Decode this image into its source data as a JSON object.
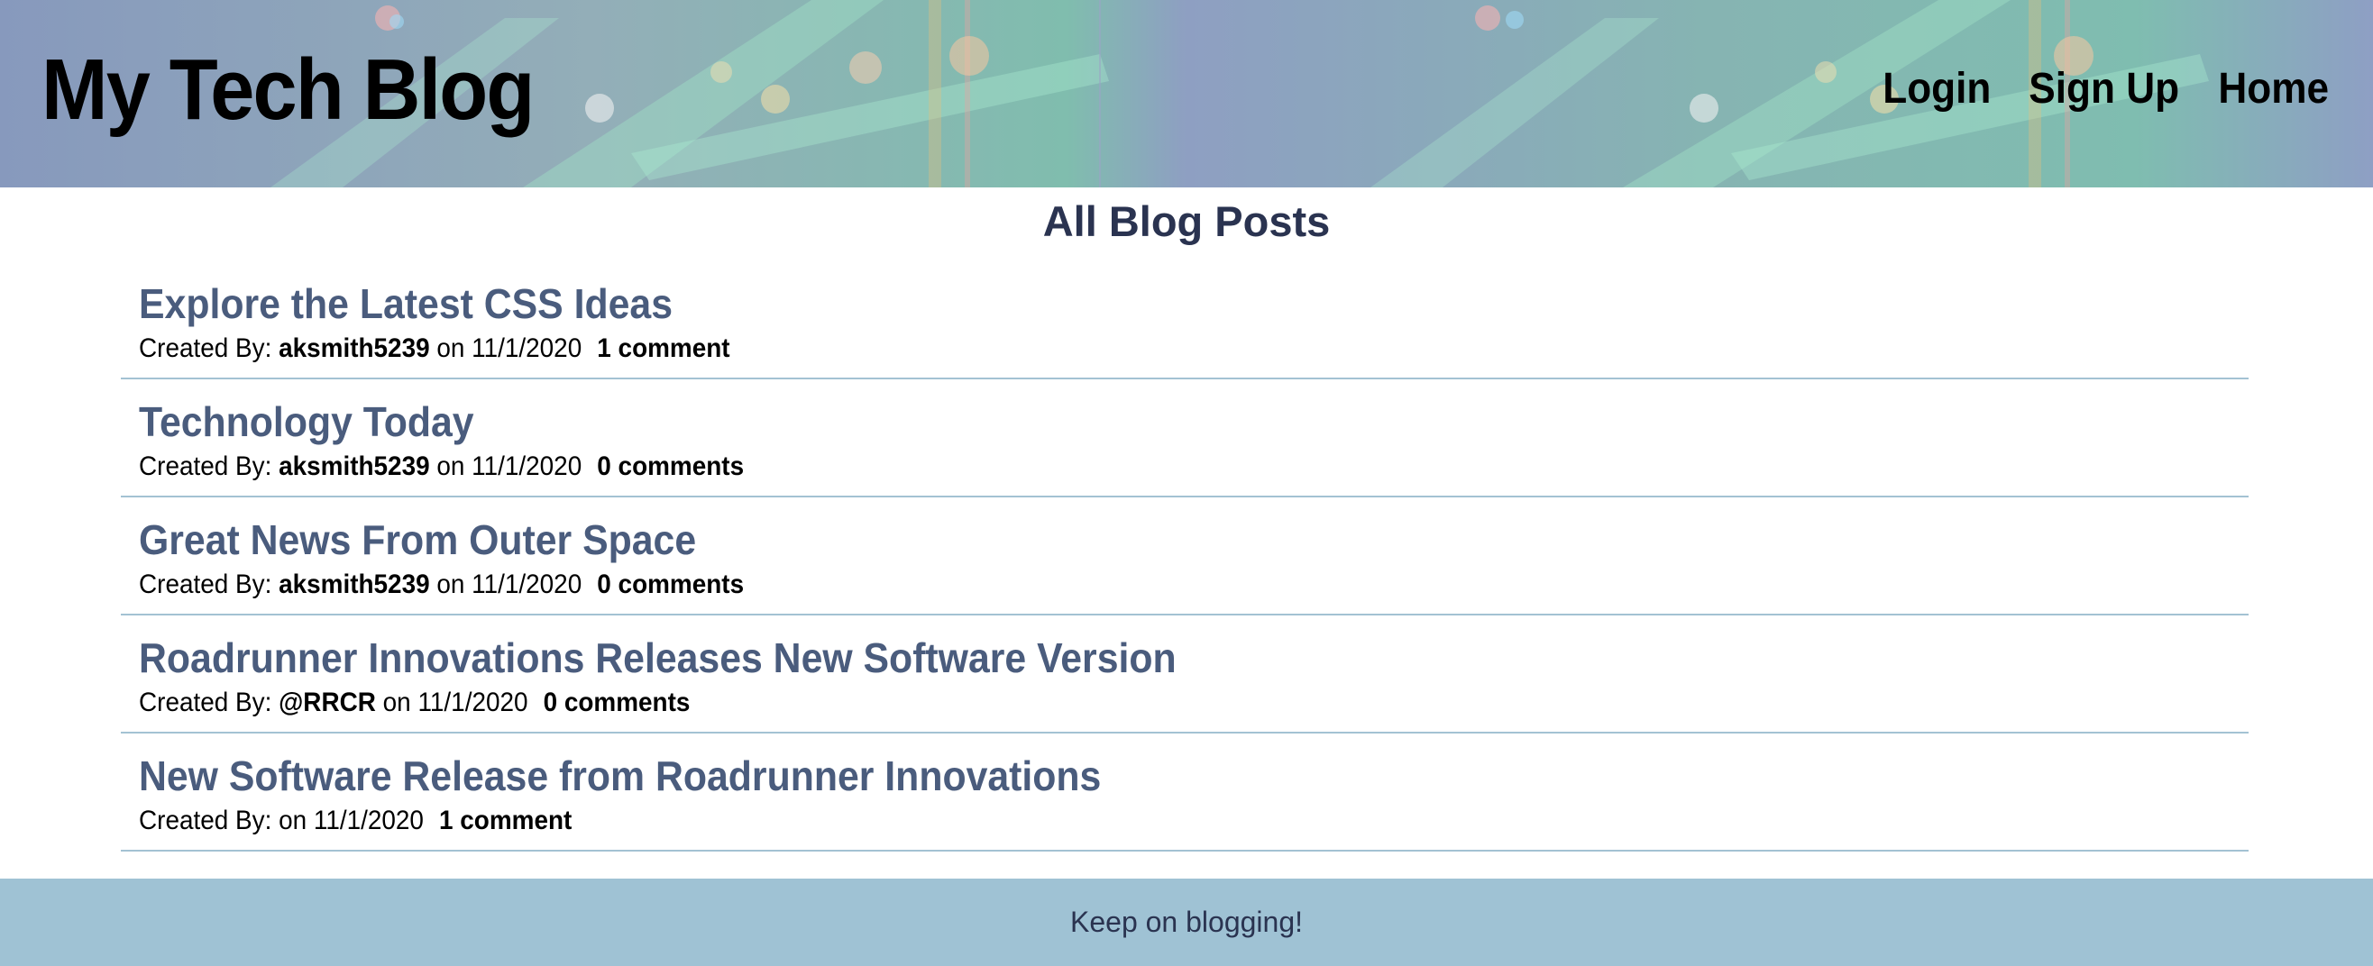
{
  "header": {
    "site_title": "My Tech Blog",
    "nav": [
      {
        "label": "Login"
      },
      {
        "label": "Sign Up"
      },
      {
        "label": "Home"
      }
    ]
  },
  "main": {
    "heading": "All Blog Posts",
    "posts": [
      {
        "title": "Explore the Latest CSS Ideas",
        "created_by_label": "Created By:",
        "author": "aksmith5239",
        "on_label": "on",
        "date": "11/1/2020",
        "comments": "1 comment"
      },
      {
        "title": "Technology Today",
        "created_by_label": "Created By:",
        "author": "aksmith5239",
        "on_label": "on",
        "date": "11/1/2020",
        "comments": "0 comments"
      },
      {
        "title": "Great News From Outer Space",
        "created_by_label": "Created By:",
        "author": "aksmith5239",
        "on_label": "on",
        "date": "11/1/2020",
        "comments": "0 comments"
      },
      {
        "title": "Roadrunner Innovations Releases New Software Version",
        "created_by_label": "Created By:",
        "author": "@RRCR",
        "on_label": "on",
        "date": "11/1/2020",
        "comments": "0 comments"
      },
      {
        "title": "New Software Release from Roadrunner Innovations",
        "created_by_label": "Created By:",
        "author": "",
        "on_label": "on",
        "date": "11/1/2020",
        "comments": "1 comment"
      }
    ]
  },
  "footer": {
    "text": "Keep on blogging!"
  },
  "colors": {
    "title_link": "#4a5c7d",
    "heading": "#2a3350",
    "divider": "#a3c2d3",
    "footer_bg": "#9fc2d4"
  }
}
